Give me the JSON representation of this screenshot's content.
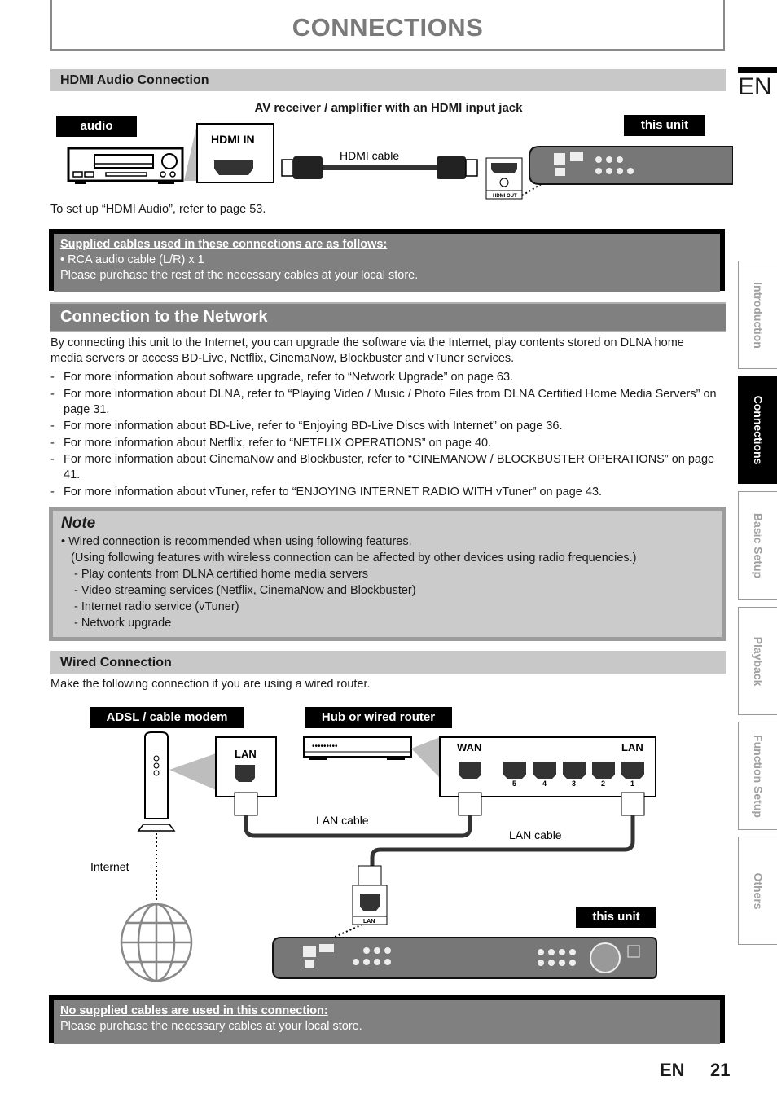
{
  "header": {
    "title": "CONNECTIONS",
    "lang_badge": "EN"
  },
  "hdmi_section": {
    "heading": "HDMI Audio Connection",
    "diagram": {
      "caption": "AV receiver / amplifier with an HDMI input jack",
      "label_audio": "audio",
      "label_this_unit": "this unit",
      "port_in": "HDMI IN",
      "cable": "HDMI cable",
      "port_out": "HDMI OUT"
    },
    "setup_note": "To set up “HDMI Audio”, refer to page 53."
  },
  "supplied_box": {
    "heading": "Supplied cables used in these connections are as follows:",
    "item": "• RCA audio cable (L/R) x 1",
    "footer": "Please purchase the rest of the necessary cables at your local store."
  },
  "network_section": {
    "heading": "Connection to the Network",
    "intro": "By connecting this unit to the Internet, you can upgrade the software via the Internet, play contents stored on DLNA home media servers or access BD-Live, Netflix, CinemaNow, Blockbuster and vTuner services.",
    "items": [
      "For more information about software upgrade, refer to “Network Upgrade” on page 63.",
      "For more information about DLNA, refer to “Playing Video / Music / Photo Files from DLNA Certified Home Media Servers” on page 31.",
      "For more information about BD-Live, refer to “Enjoying BD-Live Discs with Internet” on page 36.",
      "For more information about Netflix, refer to “NETFLIX OPERATIONS” on page 40.",
      "For more information about CinemaNow and Blockbuster, refer to “CINEMANOW / BLOCKBUSTER OPERATIONS” on page 41.",
      "For more information about vTuner, refer to “ENJOYING INTERNET RADIO WITH vTuner” on page 43."
    ]
  },
  "note": {
    "heading": "Note",
    "line1": "• Wired connection is recommended when using following features.",
    "line2": "(Using following features with wireless connection can be affected by other devices using radio frequencies.)",
    "items": [
      "- Play contents from DLNA certified home media servers",
      "- Video streaming services (Netflix, CinemaNow and Blockbuster)",
      "- Internet radio service (vTuner)",
      "- Network upgrade"
    ]
  },
  "wired_section": {
    "heading": "Wired Connection",
    "intro": "Make the following connection if you are using a wired router.",
    "diagram": {
      "label_modem": "ADSL / cable modem",
      "label_router": "Hub or wired router",
      "label_this_unit": "this unit",
      "modem_port": "LAN",
      "router_wan": "WAN",
      "router_lan": "LAN",
      "router_port_numbers": [
        "5",
        "4",
        "3",
        "2",
        "1"
      ],
      "cable1": "LAN cable",
      "cable2": "LAN cable",
      "internet": "Internet",
      "unit_port": "LAN"
    }
  },
  "no_supplied_box": {
    "heading": "No supplied cables are used in this connection:",
    "footer": "Please purchase the necessary cables at your local store."
  },
  "sidebar": {
    "tabs": [
      {
        "label": "Introduction",
        "active": false
      },
      {
        "label": "Connections",
        "active": true
      },
      {
        "label": "Basic Setup",
        "active": false
      },
      {
        "label": "Playback",
        "active": false
      },
      {
        "label": "Function Setup",
        "active": false
      },
      {
        "label": "Others",
        "active": false
      }
    ]
  },
  "footer": {
    "lang": "EN",
    "page_number": "21"
  }
}
